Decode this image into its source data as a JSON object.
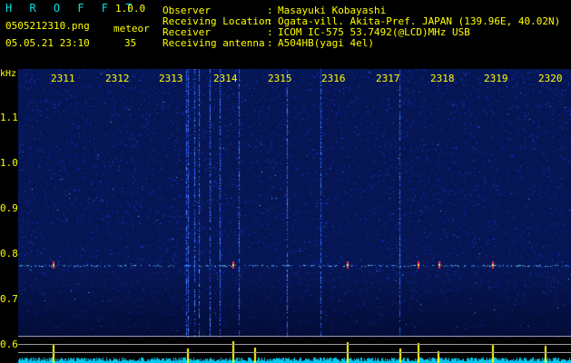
{
  "header": {
    "app_title": "H R O F F T",
    "app_version": "1.0.0",
    "filename": "0505212310.png",
    "mode_label": "meteor",
    "datetime": "05.05.21 23:10",
    "count": "35"
  },
  "info": [
    {
      "label": "Observer",
      "value": "Masayuki Kobayashi"
    },
    {
      "label": "Receiving Location",
      "value": "Ogata-vill. Akita-Pref. JAPAN (139.96E, 40.02N)"
    },
    {
      "label": "Receiver",
      "value": "ICOM IC-575 53.7492(@LCD)MHz USB"
    },
    {
      "label": "Receiving antenna",
      "value": "A504HB(yagi 4el)"
    }
  ],
  "axis": {
    "unit": "kHz",
    "y_ticks": [
      "1.1",
      "1.0",
      "0.9",
      "0.8",
      "0.7",
      "0.6"
    ],
    "time_ticks": [
      "2311",
      "2312",
      "2313",
      "2314",
      "2315",
      "2316",
      "2317",
      "2318",
      "2319",
      "2320"
    ]
  },
  "colors": {
    "text": "#ffff00",
    "background": "#000000",
    "spectrogram_noise": "#1a3cff",
    "signal": "#ff3040",
    "counter_bar": "#ffff00",
    "baseline": "#00e0ff"
  }
}
